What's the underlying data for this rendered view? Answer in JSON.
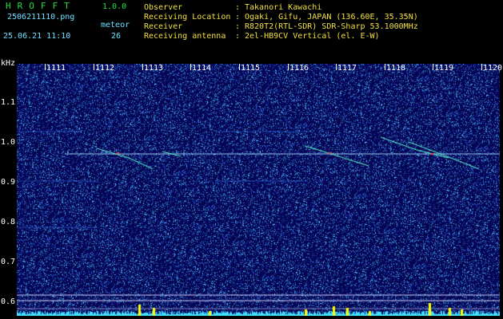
{
  "header": {
    "logo": "HROFFT",
    "version": "1.0.0",
    "filename": "2506211110.png",
    "meteor_label": "meteor",
    "datetime": "25.06.21 11:10",
    "meteor_count": "26"
  },
  "info": [
    {
      "key": "Observer",
      "value": "Takanori Kawachi"
    },
    {
      "key": "Receiving Location",
      "value": "Ogaki, Gifu, JAPAN (136.60E, 35.35N)"
    },
    {
      "key": "Receiver",
      "value": "R820T2(RTL-SDR) SDR-Sharp 53.1000MHz"
    },
    {
      "key": "Receiving antenna",
      "value": "2el-HB9CV Vertical (el. E-W)"
    }
  ],
  "separator": ":",
  "axis": {
    "y_unit": "kHz",
    "y_labels": [
      "1.1",
      "1.0",
      "0.9",
      "0.8",
      "0.7",
      "0.6"
    ],
    "x_labels": [
      "1111",
      "1112",
      "1113",
      "1114",
      "1115",
      "1116",
      "1117",
      "1118",
      "1119",
      "1120"
    ]
  },
  "colors": {
    "background": "#000000",
    "spectrogram_base": "#10106a",
    "carrier": "#a0d0ff",
    "meteor_trace": "#60ffd0",
    "histogram": "#40e0ff",
    "histogram_peaks": "#ffff00"
  }
}
